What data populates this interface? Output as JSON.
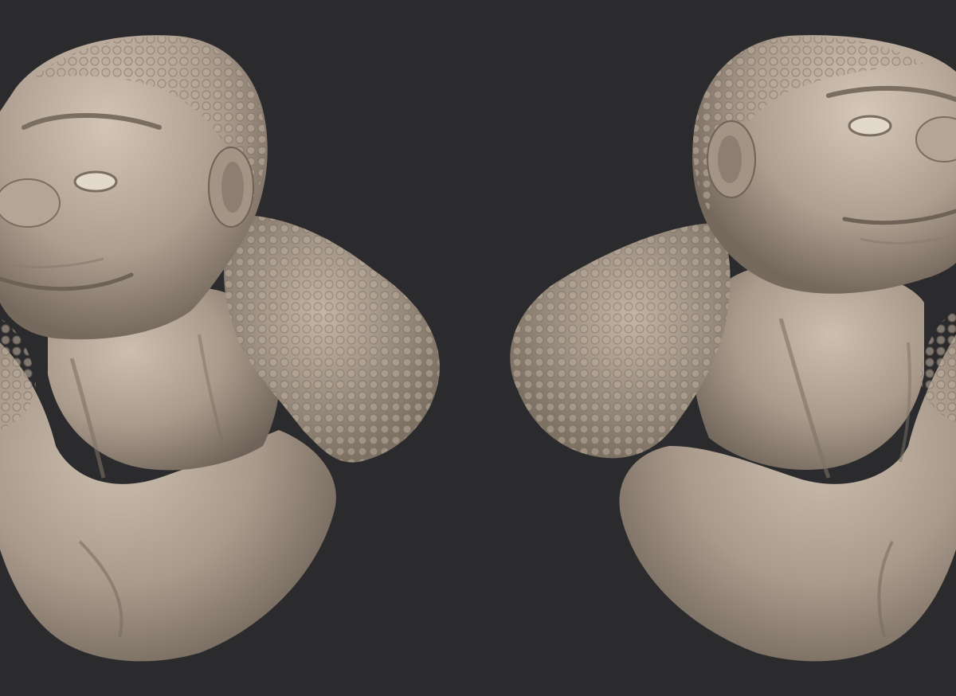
{
  "scene": {
    "background_color": "#2b2b2d",
    "material_color": "#a8998a",
    "views": [
      {
        "id": "left",
        "description_icon": "sculpt-bust-icon"
      },
      {
        "id": "right",
        "description_icon": "sculpt-bust-icon"
      }
    ]
  }
}
